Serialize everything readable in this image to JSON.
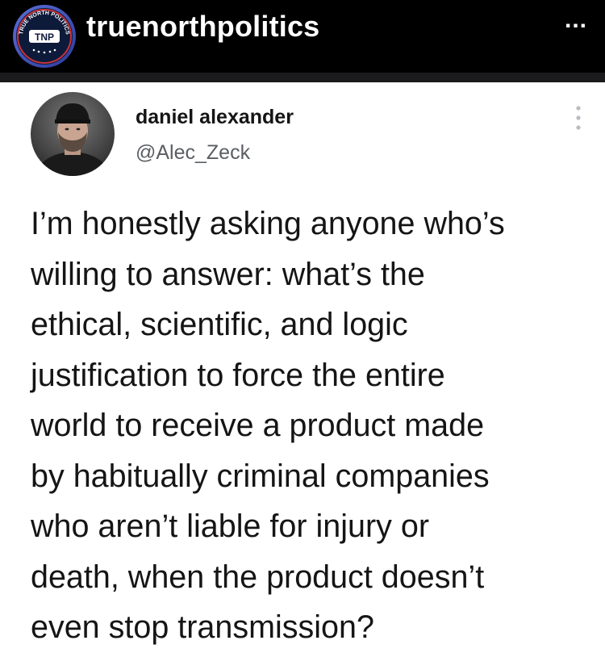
{
  "instagram_header": {
    "username": "truenorthpolitics",
    "more_label": "...",
    "avatar": {
      "initials": "TNP",
      "ring_text": "TRUE NORTH POLITICS",
      "icon": "tnp-logo-icon",
      "colors": {
        "ring": "#3a4bb8",
        "fill": "#0e1a3a",
        "accent": "#c8333a"
      }
    }
  },
  "tweet": {
    "author_name": "daniel alexander",
    "author_handle": "@Alec_Zeck",
    "menu_icon": "vertical-dots-icon",
    "lines": [
      "I’m honestly asking anyone who’s",
      "willing to answer: what’s the",
      "ethical, scientific, and logic",
      "justification to force the entire",
      "world to receive a product made",
      "by habitually criminal companies",
      "who aren’t liable for injury or",
      "death, when the product doesn’t",
      "even stop transmission?"
    ]
  }
}
